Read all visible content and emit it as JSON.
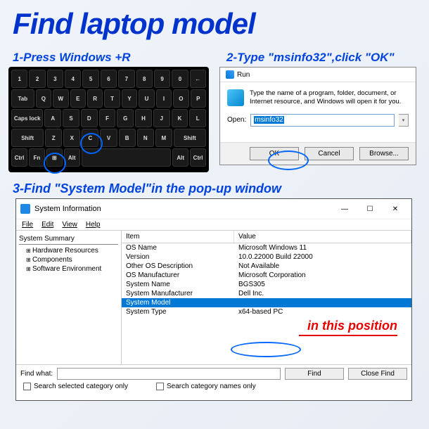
{
  "title": "Find laptop model",
  "steps": {
    "s1": "1-Press Windows +R",
    "s2": "2-Type \"msinfo32\",click \"OK\"",
    "s3": "3-Find \"System Model\"in the pop-up window"
  },
  "keyboard": {
    "row1": [
      "1",
      "2",
      "3",
      "4",
      "5",
      "6",
      "7",
      "8",
      "9",
      "0",
      "←"
    ],
    "row2_lead": "Tab",
    "row2": [
      "Q",
      "W",
      "E",
      "R",
      "T",
      "Y",
      "U",
      "I",
      "O",
      "P"
    ],
    "row3_lead": "Caps lock",
    "row3": [
      "A",
      "S",
      "D",
      "F",
      "G",
      "H",
      "J",
      "K",
      "L"
    ],
    "row4_lead": "Shift",
    "row4": [
      "Z",
      "X",
      "C",
      "V",
      "B",
      "N",
      "M"
    ],
    "row4_tail": "Shift",
    "row5": [
      "Ctrl",
      "Fn",
      "⊞",
      "Alt",
      "",
      "Alt",
      "Ctrl"
    ]
  },
  "run": {
    "title": "Run",
    "desc": "Type the name of a program, folder, document, or Internet resource, and Windows will open it for you.",
    "open_label": "Open:",
    "input_value": "msinfo32",
    "btn_ok": "OK",
    "btn_cancel": "Cancel",
    "btn_browse": "Browse..."
  },
  "sysinfo": {
    "title": "System Information",
    "menu": [
      "File",
      "Edit",
      "View",
      "Help"
    ],
    "tree_root": "System Summary",
    "tree": [
      "Hardware Resources",
      "Components",
      "Software Environment"
    ],
    "col_item": "Item",
    "col_value": "Value",
    "rows": [
      {
        "item": "OS Name",
        "value": "Microsoft Windows 11"
      },
      {
        "item": "Version",
        "value": "10.0.22000 Build 22000"
      },
      {
        "item": "Other OS Description",
        "value": "Not Available"
      },
      {
        "item": "OS Manufacturer",
        "value": "Microsoft Corporation"
      },
      {
        "item": "System Name",
        "value": "BGS305"
      },
      {
        "item": "System Manufacturer",
        "value": "Dell Inc."
      },
      {
        "item": "System Model",
        "value": ""
      },
      {
        "item": "System Type",
        "value": "x64-based PC"
      }
    ],
    "annotation": "in this position",
    "find_label": "Find what:",
    "btn_find": "Find",
    "btn_close_find": "Close Find",
    "chk1": "Search selected category only",
    "chk2": "Search category names only"
  }
}
